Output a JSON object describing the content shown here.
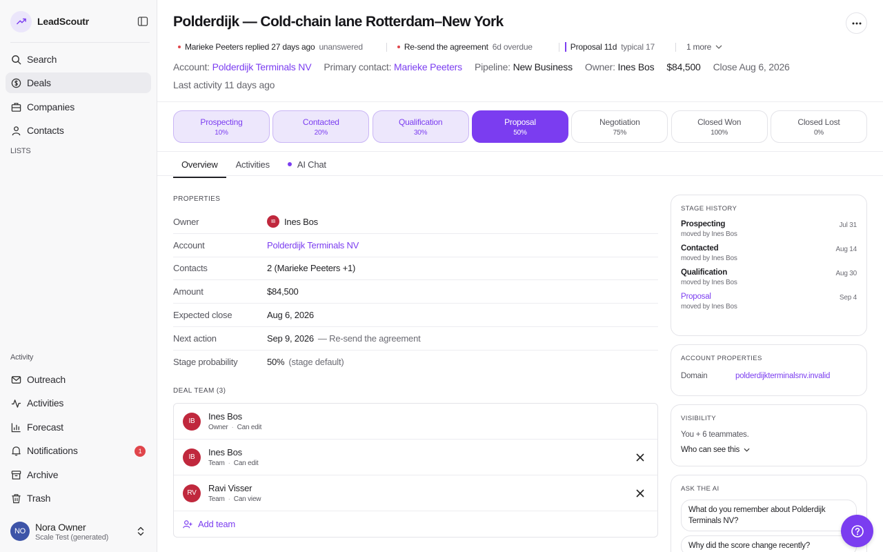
{
  "app": {
    "name": "LeadScoutr"
  },
  "nav": {
    "primary": [
      {
        "label": "Search",
        "icon": "search-icon"
      },
      {
        "label": "Deals",
        "icon": "dollar-icon",
        "active": true
      },
      {
        "label": "Companies",
        "icon": "building-icon"
      },
      {
        "label": "Contacts",
        "icon": "person-icon"
      }
    ],
    "lists_label": "LISTS",
    "activity_label": "Activity",
    "secondary": [
      {
        "label": "Outreach",
        "icon": "mail-icon"
      },
      {
        "label": "Activities",
        "icon": "pulse-icon"
      },
      {
        "label": "Forecast",
        "icon": "bar-chart-icon"
      },
      {
        "label": "Notifications",
        "icon": "bell-icon",
        "badge": "1"
      },
      {
        "label": "Archive",
        "icon": "archive-icon"
      },
      {
        "label": "Trash",
        "icon": "trash-icon"
      }
    ]
  },
  "user": {
    "initials": "NO",
    "name": "Nora Owner",
    "org": "Scale Test (generated)"
  },
  "deal": {
    "title": "Polderdijk — Cold-chain lane Rotterdam–New York",
    "alerts": [
      {
        "strong": "Marieke Peeters replied 27 days ago",
        "muted": "unanswered"
      },
      {
        "strong": "Re-send the agreement",
        "muted": "6d overdue"
      },
      {
        "strong": "Proposal 11d",
        "muted": "typical 17"
      }
    ],
    "more_alerts": "1 more",
    "meta": {
      "account_label": "Account:",
      "account": "Polderdijk Terminals NV",
      "contact_label": "Primary contact:",
      "contact": "Marieke Peeters",
      "pipeline_label": "Pipeline:",
      "pipeline": "New Business",
      "owner_label": "Owner:",
      "owner": "Ines Bos",
      "amount": "$84,500",
      "close": "Close Aug 6, 2026"
    },
    "last_activity": "Last activity 11 days ago"
  },
  "stages": [
    {
      "name": "Prospecting",
      "pct": "10%",
      "state": "past"
    },
    {
      "name": "Contacted",
      "pct": "20%",
      "state": "past"
    },
    {
      "name": "Qualification",
      "pct": "30%",
      "state": "past"
    },
    {
      "name": "Proposal",
      "pct": "50%",
      "state": "current"
    },
    {
      "name": "Negotiation",
      "pct": "75%",
      "state": "future"
    },
    {
      "name": "Closed Won",
      "pct": "100%",
      "state": "future"
    },
    {
      "name": "Closed Lost",
      "pct": "0%",
      "state": "future"
    }
  ],
  "tabs": [
    "Overview",
    "Activities",
    "AI Chat"
  ],
  "properties": {
    "heading": "PROPERTIES",
    "rows": [
      {
        "key": "Owner",
        "value": "Ines Bos",
        "avatar": "IB"
      },
      {
        "key": "Account",
        "value": "Polderdijk Terminals NV"
      },
      {
        "key": "Contacts",
        "value": "2 (Marieke Peeters +1)"
      },
      {
        "key": "Amount",
        "value": "$84,500"
      },
      {
        "key": "Expected close",
        "value": "Aug 6, 2026"
      },
      {
        "key": "Next action",
        "value": "Sep 9, 2026",
        "extra": "— Re-send the agreement"
      },
      {
        "key": "Stage probability",
        "value": "50%",
        "extra": "(stage default)"
      }
    ]
  },
  "team": {
    "heading": "DEAL TEAM (3)",
    "members": [
      {
        "initials": "IB",
        "name": "Ines Bos",
        "role": "Owner",
        "perm": "Can edit"
      },
      {
        "initials": "IB",
        "name": "Ines Bos",
        "role": "Team",
        "perm": "Can edit"
      },
      {
        "initials": "RV",
        "name": "Ravi Visser",
        "role": "Team",
        "perm": "Can view"
      }
    ],
    "add_label": "Add team"
  },
  "stage_history": {
    "heading": "STAGE HISTORY",
    "items": [
      {
        "name": "Prospecting",
        "date": "Jul 31",
        "by": "moved by Ines Bos"
      },
      {
        "name": "Contacted",
        "date": "Aug 14",
        "by": "moved by Ines Bos"
      },
      {
        "name": "Qualification",
        "date": "Aug 30",
        "by": "moved by Ines Bos"
      },
      {
        "name": "Proposal",
        "date": "Sep 4",
        "by": "moved by Ines Bos"
      }
    ]
  },
  "account_props": {
    "heading": "ACCOUNT PROPERTIES",
    "domain_label": "Domain",
    "domain": "polderdijkterminalsnv.invalid"
  },
  "visibility": {
    "heading": "VISIBILITY",
    "text": "You + 6 teammates.",
    "link": "Who can see this"
  },
  "ask_ai": {
    "heading": "ASK THE AI",
    "questions": [
      "What do you remember about Polderdijk Terminals NV?",
      "Why did the score change recently?"
    ]
  },
  "colors": {
    "accent": "#7b3df0",
    "danger": "#e0454b",
    "avatar_red": "#c0283d",
    "avatar_blue": "#3d54a8"
  }
}
